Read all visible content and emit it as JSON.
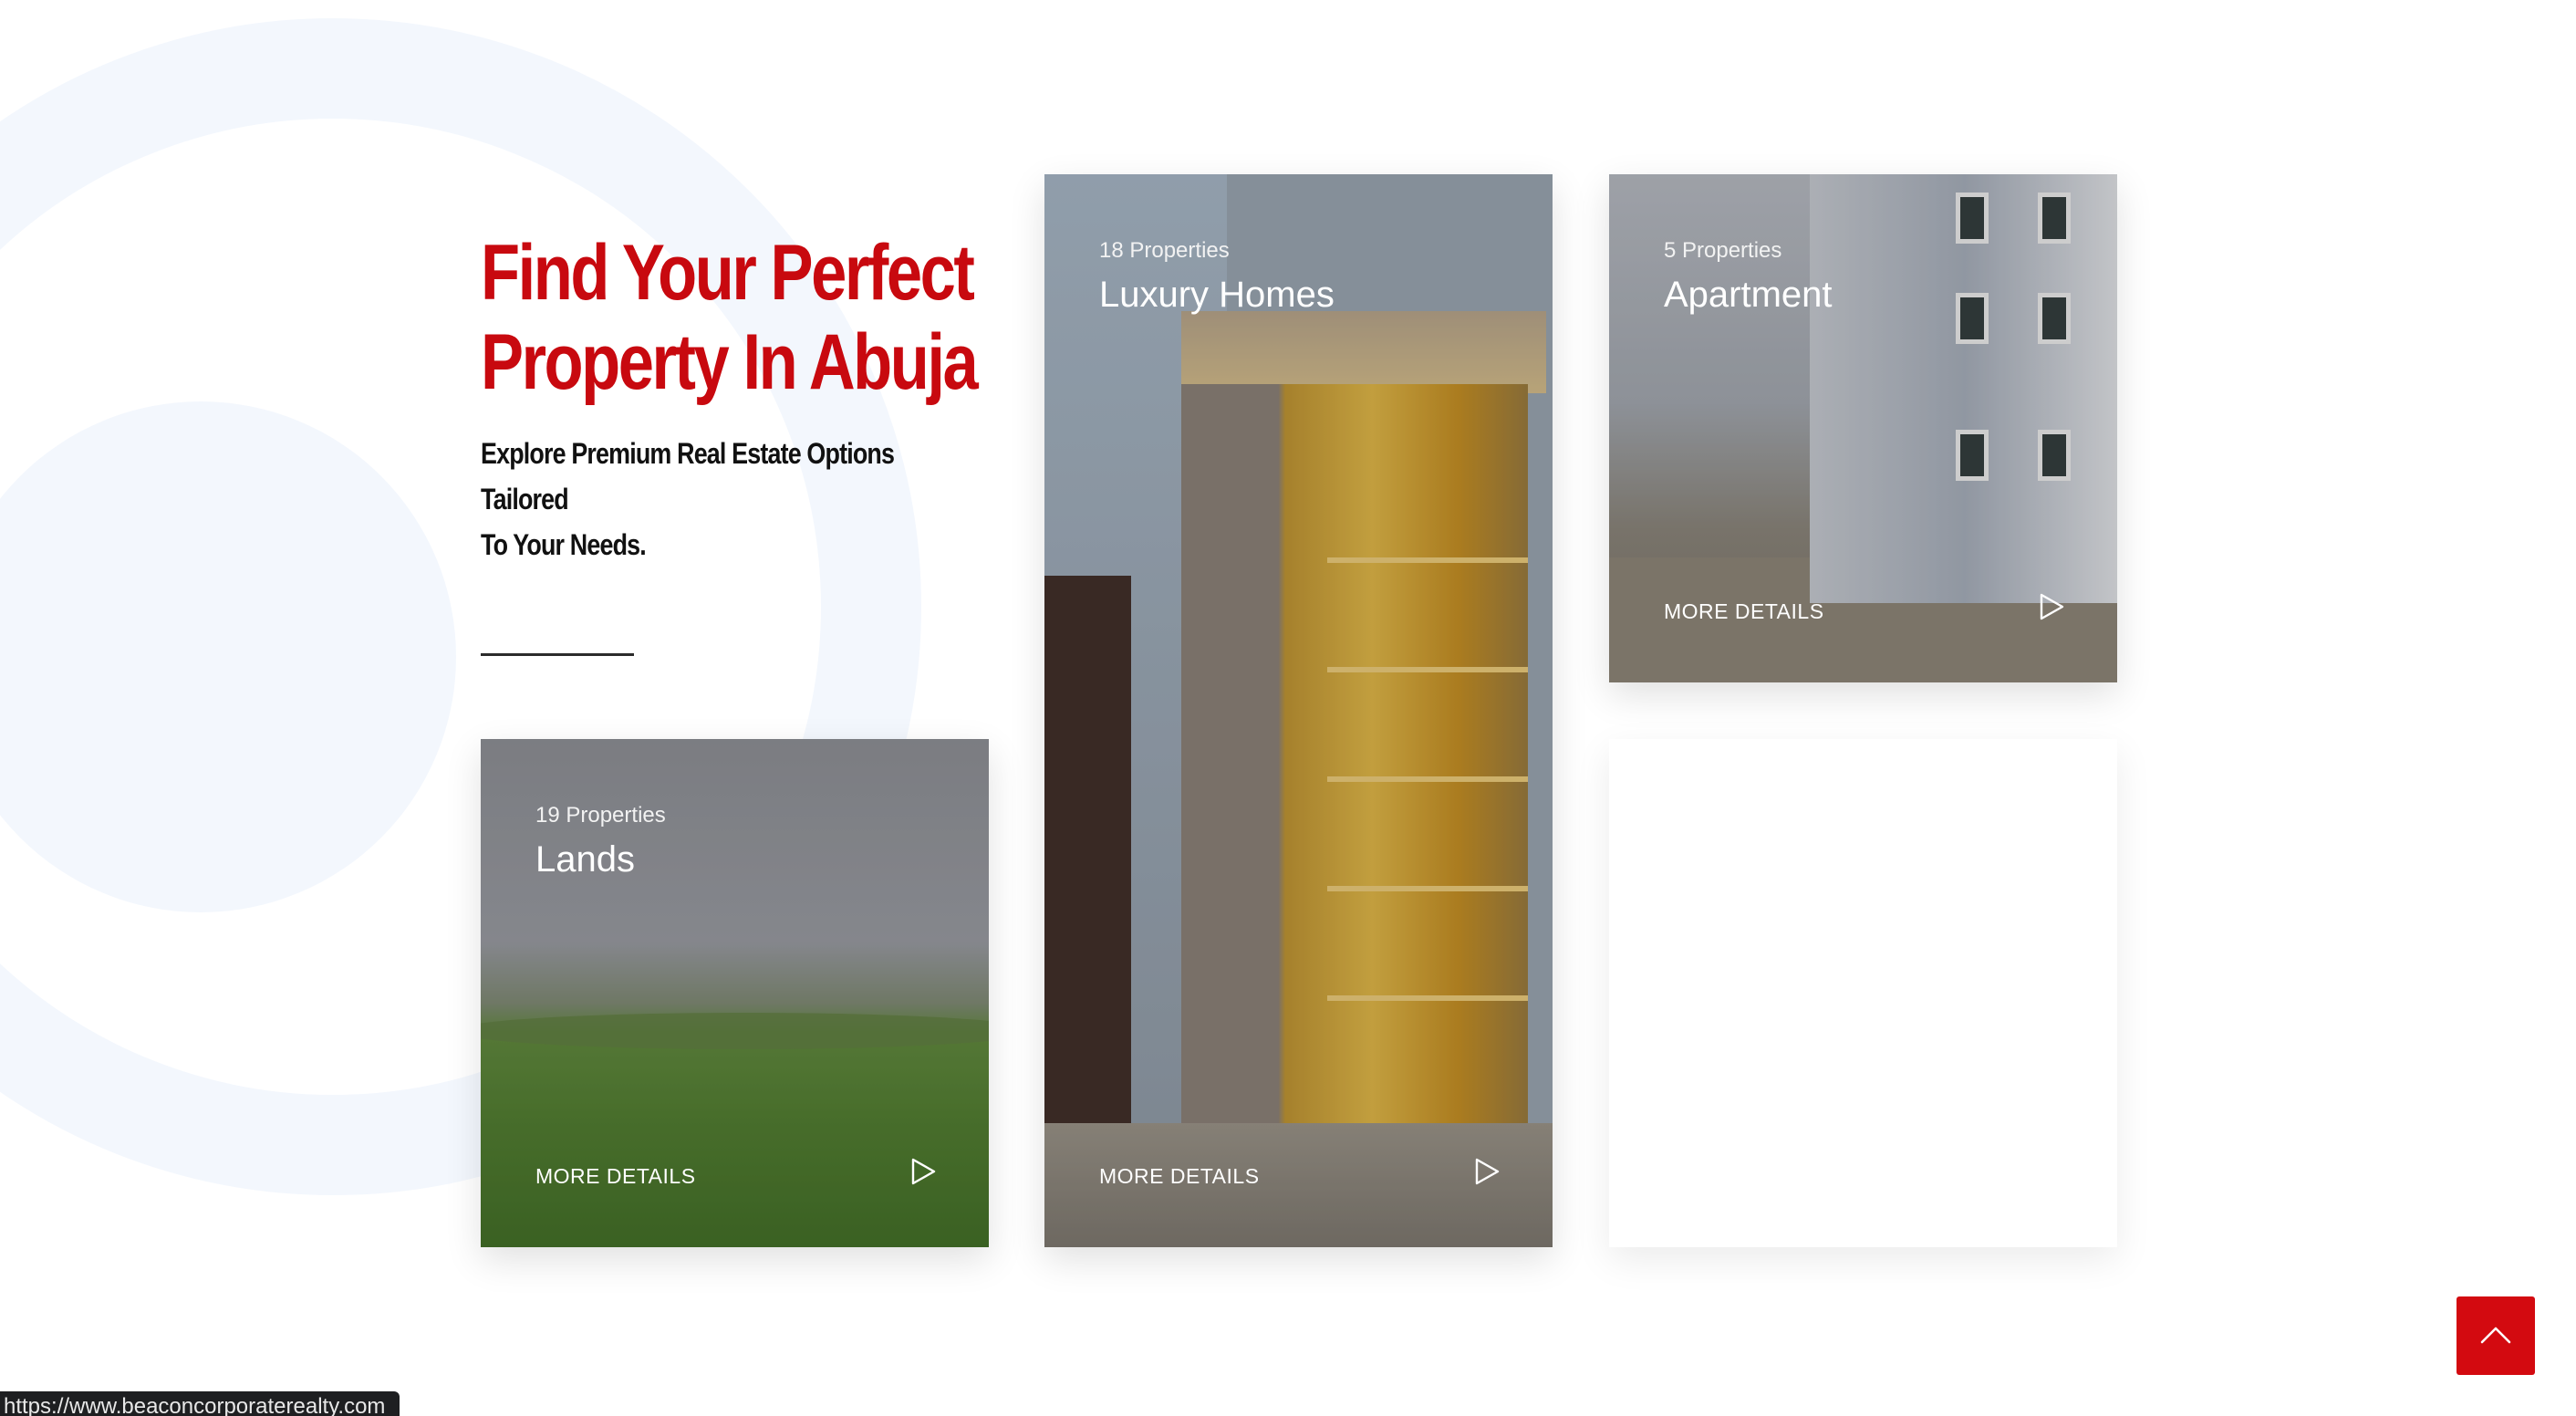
{
  "hero": {
    "headline_line1": "Find Your Perfect",
    "headline_line2": "Property In Abuja",
    "subline_line1": "Explore Premium Real Estate Options Tailored",
    "subline_line2": "To Your Needs.",
    "headline_color": "#c8090f"
  },
  "cards": [
    {
      "count": "19 Properties",
      "title": "Lands",
      "more": "MORE DETAILS",
      "icon": "play-icon"
    },
    {
      "count": "18 Properties",
      "title": "Luxury Homes",
      "more": "MORE DETAILS",
      "icon": "play-icon"
    },
    {
      "count": "5 Properties",
      "title": "Apartment",
      "more": "MORE DETAILS",
      "icon": "play-icon"
    }
  ],
  "back_to_top": {
    "icon": "chevron-up-icon",
    "color": "#d30a10"
  },
  "status_bar": {
    "url": "https://www.beaconcorporaterealty.com"
  }
}
